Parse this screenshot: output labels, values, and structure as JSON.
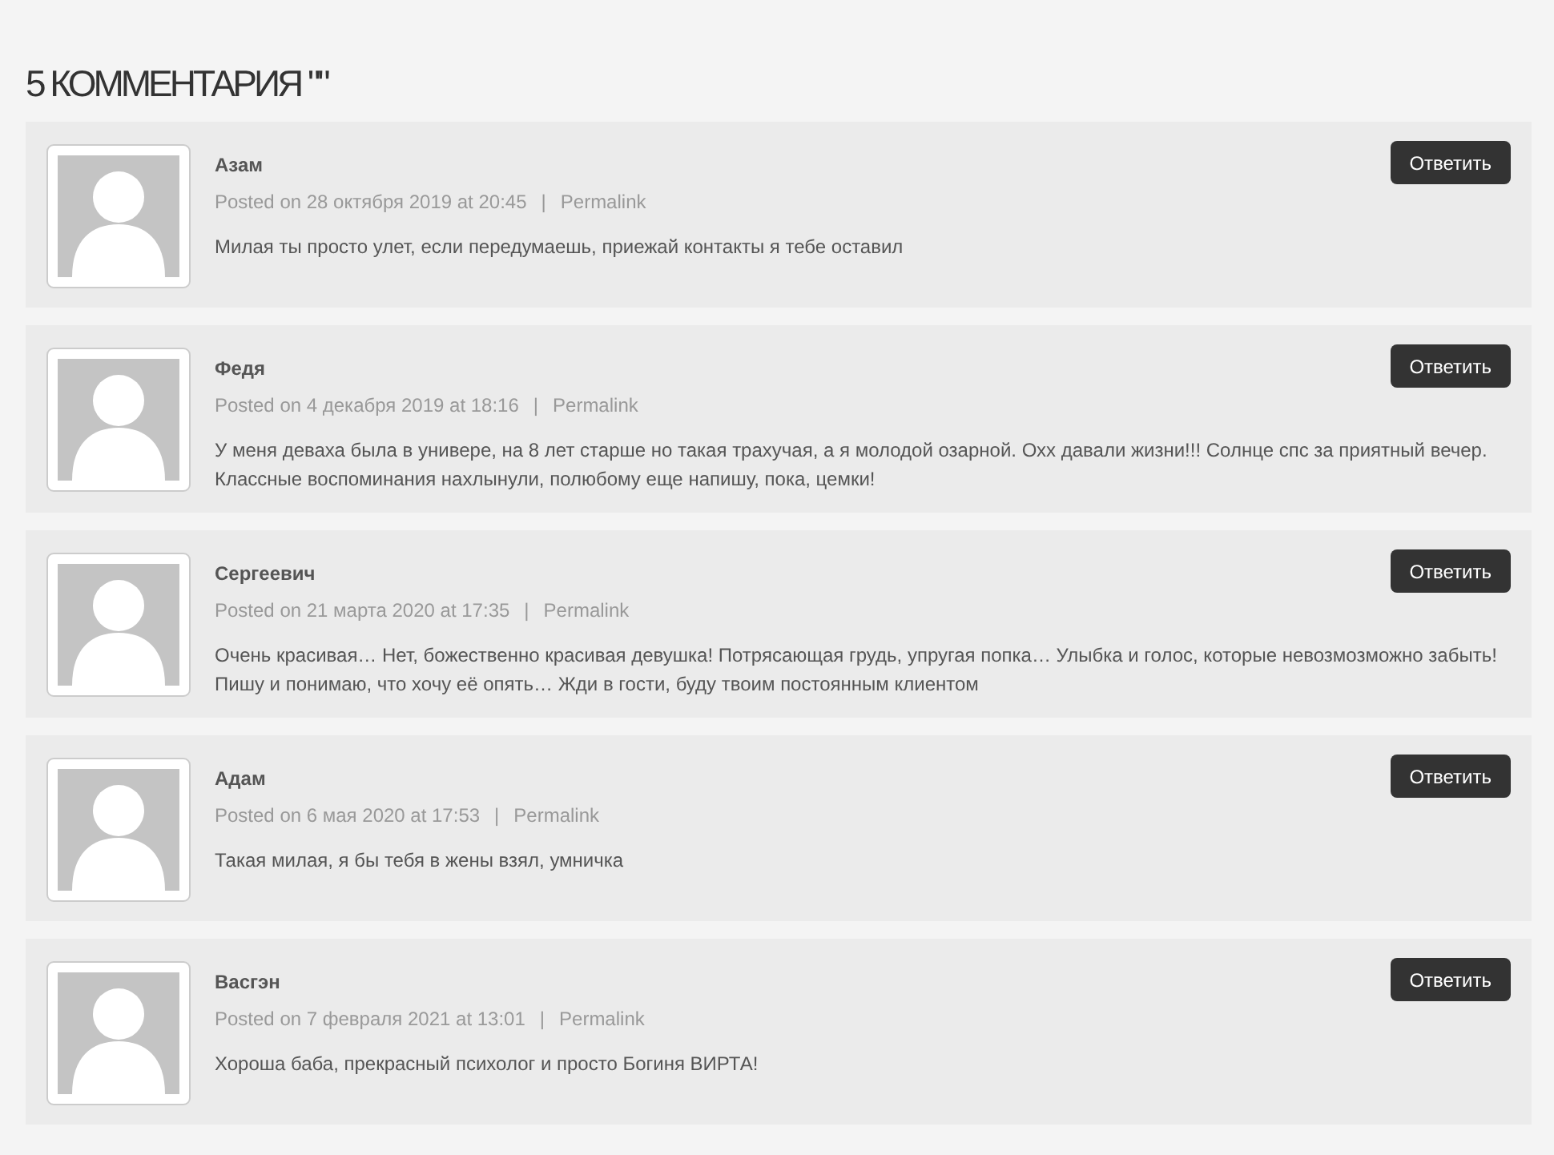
{
  "heading": "5 КОММЕНТАРИЯ \"\"",
  "comments": [
    {
      "author": "Азам",
      "posted": "Posted on 28 октября 2019 at 20:45",
      "separator": "|",
      "permalink": "Permalink",
      "text": "Милая ты просто улет, если передумаешь, приежай контакты я тебе оставил",
      "reply": "Ответить"
    },
    {
      "author": "Федя",
      "posted": "Posted on 4 декабря 2019 at 18:16",
      "separator": "|",
      "permalink": "Permalink",
      "text": "У меня деваха была в универе, на 8 лет старше но такая трахучая, а я молодой озарной. Охх давали жизни!!! Солнце спс за приятный вечер. Классные воспоминания нахлынули, полюбому еще напишу, пока, цемки!",
      "reply": "Ответить"
    },
    {
      "author": "Сергеевич",
      "posted": "Posted on 21 марта 2020 at 17:35",
      "separator": "|",
      "permalink": "Permalink",
      "text": "Очень красивая… Нет, божественно красивая девушка! Потрясающая грудь, упругая попка… Улыбка и голос, которые невозмозможно забыть! Пишу и понимаю, что хочу её опять… Жди в гости, буду твоим постоянным клиентом",
      "reply": "Ответить"
    },
    {
      "author": "Адам",
      "posted": "Posted on 6 мая 2020 at 17:53",
      "separator": "|",
      "permalink": "Permalink",
      "text": "Такая милая, я бы тебя в жены взял, умничка",
      "reply": "Ответить"
    },
    {
      "author": "Васгэн",
      "posted": "Posted on 7 февраля 2021 at 13:01",
      "separator": "|",
      "permalink": "Permalink",
      "text": "Хороша баба, прекрасный психолог и просто Богиня ВИРТА!",
      "reply": "Ответить"
    }
  ]
}
